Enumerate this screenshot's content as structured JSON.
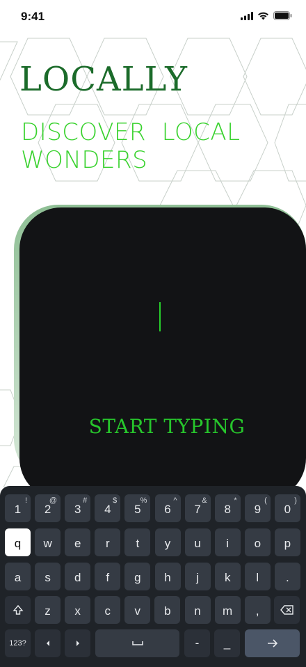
{
  "status_bar": {
    "time": "9:41"
  },
  "app": {
    "title": "LOCALLY",
    "tagline_line1": "DISCOVER  LOCAL",
    "tagline_line2": "WONDERS"
  },
  "input_card": {
    "prompt": "START TYPING"
  },
  "keyboard": {
    "number_row": [
      {
        "main": "1",
        "sup": "!"
      },
      {
        "main": "2",
        "sup": "@"
      },
      {
        "main": "3",
        "sup": "#"
      },
      {
        "main": "4",
        "sup": "$"
      },
      {
        "main": "5",
        "sup": "%"
      },
      {
        "main": "6",
        "sup": "^"
      },
      {
        "main": "7",
        "sup": "&"
      },
      {
        "main": "8",
        "sup": "*"
      },
      {
        "main": "9",
        "sup": "("
      },
      {
        "main": "0",
        "sup": ")"
      }
    ],
    "row1": [
      "q",
      "w",
      "e",
      "r",
      "t",
      "y",
      "u",
      "i",
      "o",
      "p"
    ],
    "row2": [
      "a",
      "s",
      "d",
      "f",
      "g",
      "h",
      "j",
      "k",
      "l",
      "."
    ],
    "row3": [
      "z",
      "x",
      "c",
      "v",
      "b",
      "n",
      "m",
      ","
    ],
    "symbols_label": "123?",
    "dash_label": "-",
    "underscore_label": "_",
    "active_key": "q"
  },
  "colors": {
    "brand": "#1b6b2a",
    "accent": "#39d22e",
    "card": "#121315",
    "keyboard": "#1f2328"
  }
}
